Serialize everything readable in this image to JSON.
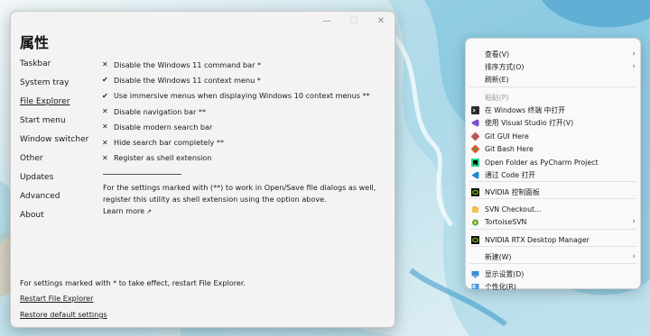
{
  "window": {
    "title": "属性",
    "controls": {
      "minimize": "—",
      "maximize": "☐",
      "close": "✕"
    }
  },
  "nav": [
    {
      "label": "Taskbar",
      "active": false
    },
    {
      "label": "System tray",
      "active": false
    },
    {
      "label": "File Explorer",
      "active": true
    },
    {
      "label": "Start menu",
      "active": false
    },
    {
      "label": "Window switcher",
      "active": false
    },
    {
      "label": "Other",
      "active": false
    },
    {
      "label": "Updates",
      "active": false
    },
    {
      "label": "Advanced",
      "active": false
    },
    {
      "label": "About",
      "active": false
    }
  ],
  "options": [
    {
      "mark": "✕",
      "label": "Disable the Windows 11 command bar *"
    },
    {
      "mark": "✔",
      "label": "Disable the Windows 11 context menu *"
    },
    {
      "mark": "✔",
      "label": "Use immersive menus when displaying Windows 10 context menus **"
    },
    {
      "mark": "✕",
      "label": "Disable navigation bar **"
    },
    {
      "mark": "✕",
      "label": "Disable modern search bar"
    },
    {
      "mark": "✕",
      "label": "Hide search bar completely **"
    },
    {
      "mark": "✕",
      "label": "Register as shell extension"
    }
  ],
  "note": "For the settings marked with (**) to work in Open/Save file dialogs as well, register this utility as shell extension using the option above.",
  "learn_more": "Learn more",
  "learn_more_arrow": "↗",
  "footer": {
    "note": "For settings marked with * to take effect, restart File Explorer.",
    "restart": "Restart File Explorer",
    "restore": "Restore default settings"
  },
  "context_menu": {
    "items": [
      {
        "label": "查看(V)",
        "icon": "none",
        "submenu": true
      },
      {
        "label": "排序方式(O)",
        "icon": "none",
        "submenu": true
      },
      {
        "label": "刷新(E)",
        "icon": "none",
        "submenu": false
      },
      {
        "label": "粘贴(P)",
        "icon": "none",
        "submenu": false,
        "disabled": true
      },
      {
        "label": "在 Windows 终端 中打开",
        "icon": "terminal-icon",
        "submenu": false
      },
      {
        "label": "使用 Visual Studio 打开(V)",
        "icon": "visual-studio-icon",
        "submenu": false
      },
      {
        "label": "Git GUI Here",
        "icon": "git-gui-icon",
        "submenu": false
      },
      {
        "label": "Git Bash Here",
        "icon": "git-bash-icon",
        "submenu": false
      },
      {
        "label": "Open Folder as PyCharm Project",
        "icon": "pycharm-icon",
        "submenu": false
      },
      {
        "label": "通过 Code 打开",
        "icon": "vscode-icon",
        "submenu": false
      },
      {
        "label": "NVIDIA 控制面板",
        "icon": "nvidia-icon",
        "submenu": false
      },
      {
        "label": "SVN Checkout...",
        "icon": "svn-checkout-icon",
        "submenu": false
      },
      {
        "label": "TortoiseSVN",
        "icon": "tortoisesvn-icon",
        "submenu": true
      },
      {
        "label": "NVIDIA RTX Desktop Manager",
        "icon": "nvidia-icon",
        "submenu": false
      },
      {
        "label": "新建(W)",
        "icon": "none",
        "submenu": true
      },
      {
        "label": "显示设置(D)",
        "icon": "display-settings-icon",
        "submenu": false
      },
      {
        "label": "个性化(R)",
        "icon": "personalize-icon",
        "submenu": false
      }
    ],
    "submenu_glyph": "›"
  },
  "colors": {
    "window_bg": "#f3f3f3",
    "menu_bg": "#f9f9f9",
    "wallpaper_base": "#cfe6ee",
    "wallpaper_accent": "#2a8fc4"
  }
}
